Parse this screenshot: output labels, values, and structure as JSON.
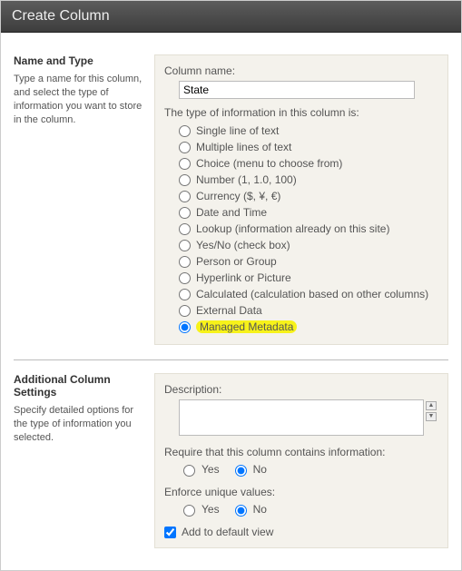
{
  "header": {
    "title": "Create Column"
  },
  "section1": {
    "heading": "Name and Type",
    "help": "Type a name for this column, and select the type of information you want to store in the column.",
    "column_name_label": "Column name:",
    "column_name_value": "State",
    "type_intro": "The type of information in this column is:",
    "types": [
      {
        "label": "Single line of text"
      },
      {
        "label": "Multiple lines of text"
      },
      {
        "label": "Choice (menu to choose from)"
      },
      {
        "label": "Number (1, 1.0, 100)"
      },
      {
        "label": "Currency ($, ¥, €)"
      },
      {
        "label": "Date and Time"
      },
      {
        "label": "Lookup (information already on this site)"
      },
      {
        "label": "Yes/No (check box)"
      },
      {
        "label": "Person or Group"
      },
      {
        "label": "Hyperlink or Picture"
      },
      {
        "label": "Calculated (calculation based on other columns)"
      },
      {
        "label": "External Data"
      },
      {
        "label": "Managed Metadata",
        "selected": true,
        "highlight": true
      }
    ]
  },
  "section2": {
    "heading": "Additional Column Settings",
    "help": "Specify detailed options for the type of information you selected.",
    "description_label": "Description:",
    "description_value": "",
    "require_label": "Require that this column contains information:",
    "yes": "Yes",
    "no": "No",
    "require_value": "No",
    "unique_label": "Enforce unique values:",
    "unique_value": "No",
    "default_view_label": "Add to default view",
    "default_view_checked": true
  }
}
